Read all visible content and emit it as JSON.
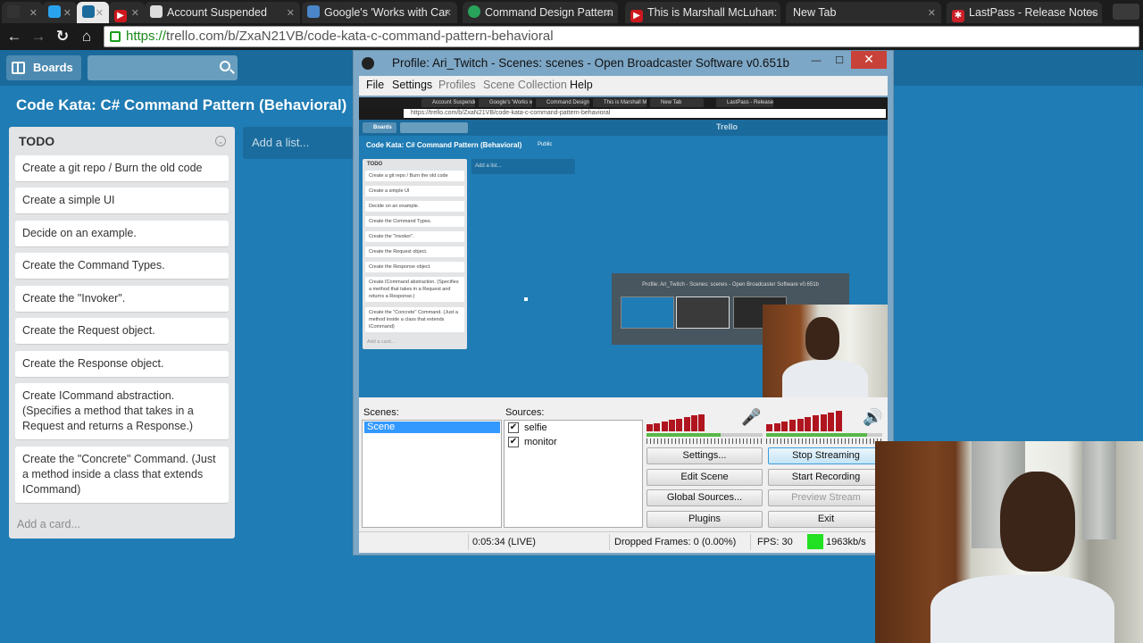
{
  "browser": {
    "tabs": [
      {
        "label": "",
        "icon": "github-icon",
        "color": "#333333"
      },
      {
        "label": "",
        "icon": "twitter-icon",
        "color": "#2aa3ef"
      },
      {
        "label": "",
        "icon": "trello-icon",
        "color": "#1a6a9c",
        "active": true
      },
      {
        "label": "",
        "icon": "youtube-icon",
        "color": "#cc181e"
      },
      {
        "label": "Account Suspended",
        "icon": "page-icon",
        "color": "#dddddd"
      },
      {
        "label": "Google's 'Works with Car",
        "icon": "page-icon",
        "color": "#4a86c8"
      },
      {
        "label": "Command Design Pattern",
        "icon": "page-icon",
        "color": "#29a35c"
      },
      {
        "label": "This is Marshall McLuhan:",
        "icon": "youtube-icon",
        "color": "#cc181e"
      },
      {
        "label": "New Tab",
        "icon": "",
        "color": ""
      },
      {
        "label": "LastPass - Release Notes",
        "icon": "lastpass-icon",
        "color": "#cc2029"
      }
    ],
    "url_scheme": "https://",
    "url_rest": "trello.com/b/ZxaN21VB/code-kata-c-command-pattern-behavioral"
  },
  "trello": {
    "boards_label": "Boards",
    "board_title": "Code Kata: C# Command Pattern (Behavioral)",
    "list_title": "TODO",
    "cards": [
      "Create a git repo / Burn the old code",
      "Create a simple UI",
      "Decide on an example.",
      "Create the Command Types.",
      "Create the \"Invoker\".",
      "Create the Request object.",
      "Create the Response object.",
      "Create ICommand abstraction. (Specifies a method that takes in a Request and returns a Response.)",
      "Create the \"Concrete\" Command. (Just a method inside a class that extends ICommand)"
    ],
    "add_card": "Add a card...",
    "add_list": "Add a list..."
  },
  "obs": {
    "title": "Profile: Ari_Twitch - Scenes: scenes - Open Broadcaster Software v0.651b",
    "menu": [
      "File",
      "Settings",
      "Profiles",
      "Scene Collection",
      "Help"
    ],
    "scenes_label": "Scenes:",
    "sources_label": "Sources:",
    "scenes": [
      "Scene"
    ],
    "sources": [
      {
        "name": "selfie",
        "checked": true
      },
      {
        "name": "monitor",
        "checked": true
      }
    ],
    "buttons": {
      "settings": "Settings...",
      "stop_streaming": "Stop Streaming",
      "edit_scene": "Edit Scene",
      "start_recording": "Start Recording",
      "global_sources": "Global Sources...",
      "preview_stream": "Preview Stream",
      "plugins": "Plugins",
      "exit": "Exit"
    },
    "status": {
      "time": "0:05:34 (LIVE)",
      "dropped": "Dropped Frames: 0 (0.00%)",
      "fps": "FPS: 30",
      "bitrate": "1963kb/s"
    },
    "mic_level": 0.64,
    "desktop_level": 0.87,
    "colors": {
      "meter": "#b0151f",
      "level_fill": "#57b847",
      "bitrate_ok": "#22e022"
    }
  },
  "preview": {
    "tabs": [
      "Account Suspended",
      "Google's 'Works with Car",
      "Command Design Pattern",
      "This is Marshall McLuhan",
      "New Tab",
      "LastPass - Release Notes"
    ],
    "url": "https://trello.com/b/ZxaN21VB/code-kata-c-command-pattern-behavioral",
    "boards_label": "Boards",
    "logo": "Trello",
    "board_title": "Code Kata: C# Command Pattern (Behavioral)",
    "public_label": "Public",
    "list_title": "TODO",
    "cards": [
      "Create a git repo / Burn the old code",
      "Create a simple UI",
      "Decide on an example.",
      "Create the Command Types.",
      "Create the \"Invoker\".",
      "Create the Request object.",
      "Create the Response object.",
      "Create ICommand abstraction. (Specifies a method that takes in a Request and returns a Response.)",
      "Create the \"Concrete\" Command. (Just a method inside a class that extends ICommand)"
    ],
    "add_card": "Add a card...",
    "add_list": "Add a list...",
    "switcher_title": "Profile: Ari_Twitch - Scenes: scenes - Open Broadcaster Software v0.651b"
  }
}
